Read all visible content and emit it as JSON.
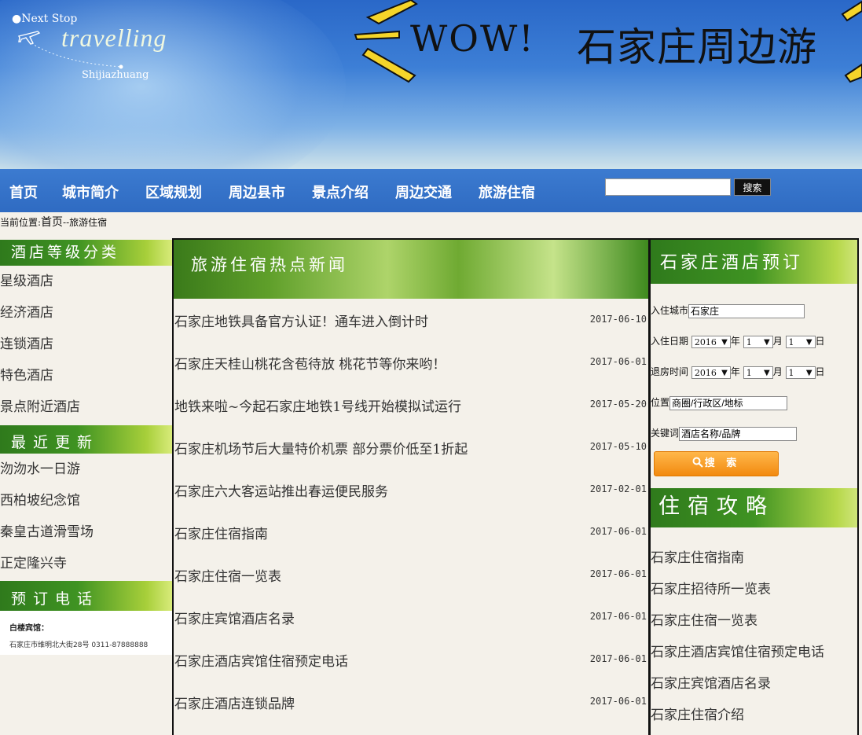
{
  "banner": {
    "logo_next": "●Next Stop",
    "logo_travel": "travelling",
    "logo_city": "Shijiazhuang",
    "wow": "WOW!",
    "title": "石家庄周边游"
  },
  "nav": {
    "items": [
      "首页",
      "城市简介",
      "区域规划",
      "周边县市",
      "景点介绍",
      "周边交通",
      "旅游住宿"
    ],
    "search_placeholder": "",
    "search_button": "搜索"
  },
  "breadcrumb": {
    "prefix": "当前位置:",
    "home": "首页",
    "current": "--旅游住宿"
  },
  "left": {
    "hotel_levels_title": "酒店等级分类",
    "hotel_levels": [
      "星级酒店",
      "经济酒店",
      "连锁酒店",
      "特色酒店",
      "景点附近酒店"
    ],
    "recent_title": "最近更新",
    "recent": [
      "沕沕水一日游",
      "西柏坡纪念馆",
      "秦皇古道滑雪场",
      "正定隆兴寺"
    ],
    "booking_phone_title": "预订电话",
    "contact_name": "白楼宾馆：",
    "contact_address": "石家庄市维明北大街28号 0311-87888888"
  },
  "middle": {
    "title": "旅游住宿热点新闻",
    "news": [
      {
        "title": "石家庄地铁具备官方认证！通车进入倒计时",
        "date": "2017-06-10"
      },
      {
        "title": "石家庄天桂山桃花含苞待放 桃花节等你来哟！",
        "date": "2017-06-01"
      },
      {
        "title": "地铁来啦~今起石家庄地铁1号线开始模拟试运行",
        "date": "2017-05-20"
      },
      {
        "title": "石家庄机场节后大量特价机票 部分票价低至1折起",
        "date": "2017-05-10"
      },
      {
        "title": "石家庄六大客运站推出春运便民服务",
        "date": "2017-02-01"
      },
      {
        "title": "石家庄住宿指南",
        "date": "2017-06-01"
      },
      {
        "title": "石家庄住宿一览表",
        "date": "2017-06-01"
      },
      {
        "title": "石家庄宾馆酒店名录",
        "date": "2017-06-01"
      },
      {
        "title": "石家庄酒店宾馆住宿预定电话",
        "date": "2017-06-01"
      },
      {
        "title": "石家庄酒店连锁品牌",
        "date": "2017-06-01"
      }
    ]
  },
  "right": {
    "booking_title": "石家庄酒店预订",
    "city_label": "入住城市",
    "city_value": "石家庄",
    "checkin_label": "入住日期",
    "checkout_label": "退房时间",
    "year_value": "2016",
    "month_value": "1",
    "day_value": "1",
    "year_unit": "年",
    "month_unit": "月",
    "day_unit": "日",
    "location_label": "位置",
    "location_value": "商圈/行政区/地标",
    "keyword_label": "关键词",
    "keyword_value": "酒店名称/品牌",
    "search_button": "搜 索",
    "guide_title": "住宿攻略",
    "guides": [
      "石家庄住宿指南",
      "石家庄招待所一览表",
      "石家庄住宿一览表",
      "石家庄酒店宾馆住宿预定电话",
      "石家庄宾馆酒店名录",
      "石家庄住宿介绍"
    ]
  },
  "colors": {
    "nav_blue": "#2f6bc2",
    "header_green": "#3f9322",
    "button_orange": "#f28a10"
  }
}
